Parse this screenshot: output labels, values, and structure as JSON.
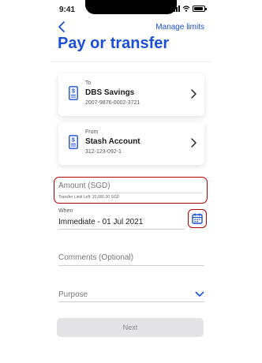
{
  "status_bar": {
    "time": "9:41"
  },
  "header": {
    "back_icon": "chevron-left-icon",
    "manage_label": "Manage limits",
    "title": "Pay or transfer"
  },
  "to_account": {
    "caption": "To",
    "name": "DBS Savings",
    "number": "2007-9876-0002-3721",
    "icon": "document-dollar-icon"
  },
  "from_account": {
    "caption": "From",
    "name": "Stash Account",
    "number": "312-123-092-1",
    "icon": "document-dollar-icon"
  },
  "amount": {
    "placeholder": "Amount (SGD)",
    "hint": "Transfer Limit Left: 20,000.00 SGD"
  },
  "when": {
    "label": "When",
    "value": "Immediate - 01 Jul 2021",
    "icon": "calendar-icon"
  },
  "comments": {
    "placeholder": "Comments (Optional)"
  },
  "purpose": {
    "placeholder": "Purpose",
    "icon": "chevron-down-icon"
  },
  "next_label": "Next",
  "colors": {
    "accent": "#1a4fd6",
    "error": "#b00000",
    "disabled_bg": "#e4e4e6"
  }
}
